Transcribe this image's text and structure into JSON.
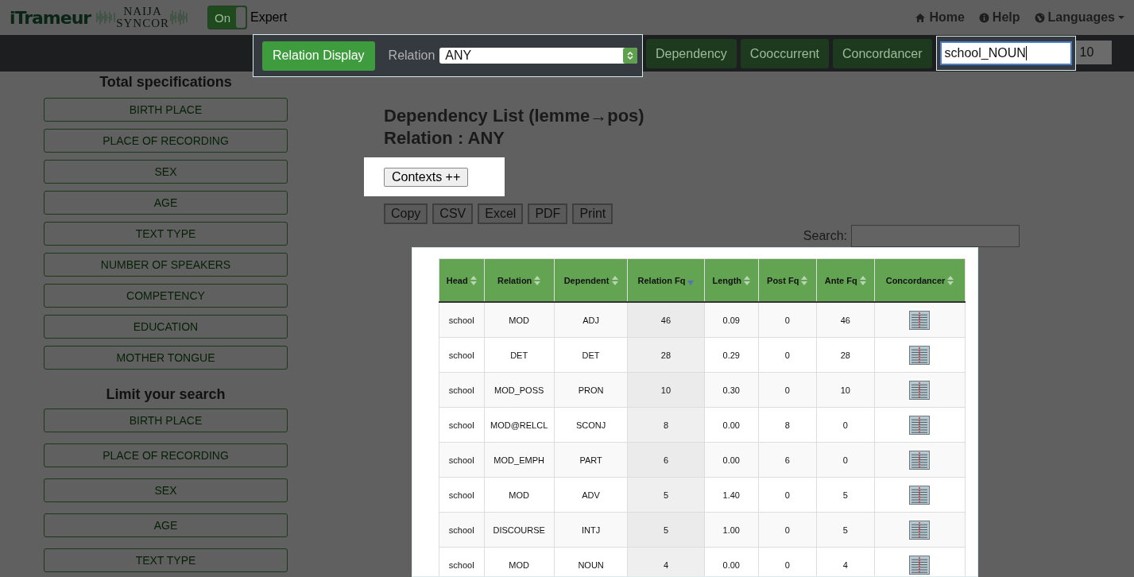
{
  "header": {
    "logo_text": "iTrameur",
    "logo2_lines": [
      "NAIJA",
      "SYNCOR"
    ],
    "toggle": {
      "label": "On",
      "on": true
    },
    "mode_label": "Expert",
    "links": [
      {
        "kind": "home",
        "label": "Home"
      },
      {
        "kind": "help",
        "label": "Help"
      },
      {
        "kind": "languages",
        "label": "Languages"
      }
    ]
  },
  "navbar": {
    "relation_display": "Relation Display",
    "relation_label": "Relation",
    "relation_value": "ANY",
    "buttons": [
      "Dependency",
      "Cooccurrent",
      "Concordancer"
    ],
    "query": "school_NOUN",
    "count": "10"
  },
  "sidebar": {
    "sections": [
      {
        "title": "Total specifications",
        "items": [
          "BIRTH PLACE",
          "PLACE OF RECORDING",
          "SEX",
          "AGE",
          "TEXT TYPE",
          "NUMBER OF SPEAKERS",
          "COMPETENCY",
          "EDUCATION",
          "MOTHER TONGUE"
        ]
      },
      {
        "title": "Limit your search",
        "items": [
          "BIRTH PLACE",
          "PLACE OF RECORDING",
          "SEX",
          "AGE",
          "TEXT TYPE"
        ]
      }
    ]
  },
  "main": {
    "title": "Dependency List (lemme→pos)",
    "subtitle": "Relation : ANY",
    "contexts_button": "Contexts ++",
    "export_buttons": [
      "Copy",
      "CSV",
      "Excel",
      "PDF",
      "Print"
    ],
    "search_label": "Search:",
    "table": {
      "columns": [
        {
          "label": "Head",
          "sorted": false
        },
        {
          "label": "Relation",
          "sorted": false
        },
        {
          "label": "Dependent",
          "sorted": false
        },
        {
          "label": "Relation Fq",
          "sorted": true
        },
        {
          "label": "Length",
          "sorted": false
        },
        {
          "label": "Post Fq",
          "sorted": false
        },
        {
          "label": "Ante Fq",
          "sorted": false
        },
        {
          "label": "Concordancer",
          "sorted": false
        }
      ],
      "rows": [
        [
          "school",
          "MOD",
          "ADJ",
          "46",
          "0.09",
          "0",
          "46"
        ],
        [
          "school",
          "DET",
          "DET",
          "28",
          "0.29",
          "0",
          "28"
        ],
        [
          "school",
          "MOD_POSS",
          "PRON",
          "10",
          "0.30",
          "0",
          "10"
        ],
        [
          "school",
          "MOD@RELCL",
          "SCONJ",
          "8",
          "0.00",
          "8",
          "0"
        ],
        [
          "school",
          "MOD_EMPH",
          "PART",
          "6",
          "0.00",
          "6",
          "0"
        ],
        [
          "school",
          "MOD",
          "ADV",
          "5",
          "1.40",
          "0",
          "5"
        ],
        [
          "school",
          "DISCOURSE",
          "INTJ",
          "5",
          "1.00",
          "0",
          "5"
        ],
        [
          "school",
          "MOD",
          "NOUN",
          "4",
          "0.00",
          "0",
          "4"
        ]
      ]
    }
  }
}
